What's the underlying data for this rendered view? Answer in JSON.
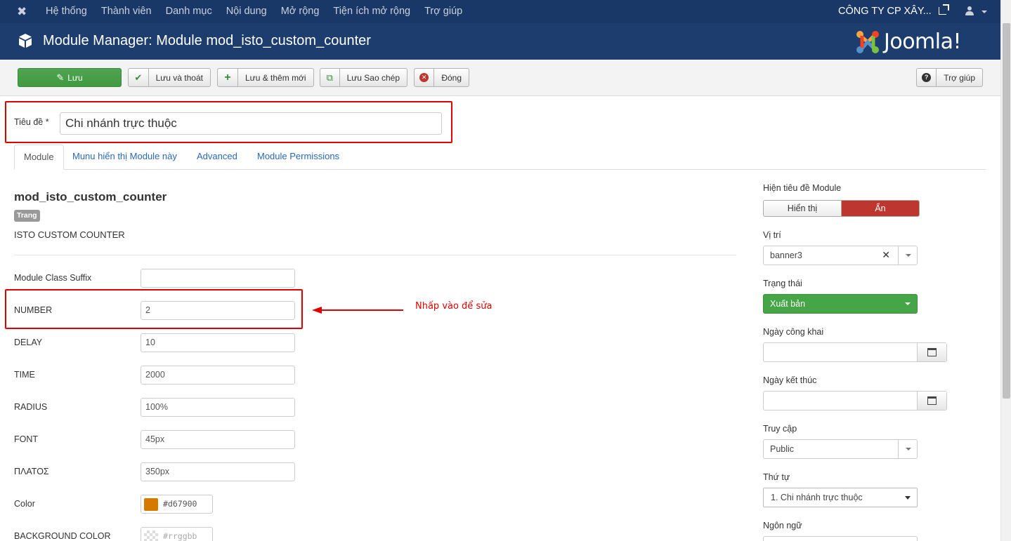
{
  "navbar": {
    "menu": [
      "Hệ thống",
      "Thành viên",
      "Danh mục",
      "Nội dung",
      "Mở rộng",
      "Tiện ích mở rộng",
      "Trợ giúp"
    ],
    "site_name": "CÔNG TY CP XÂY..."
  },
  "header": {
    "title": "Module Manager: Module mod_isto_custom_counter",
    "logo_text": "Joomla!"
  },
  "toolbar": {
    "save": "Lưu",
    "save_close": "Lưu và thoát",
    "save_new": "Lưu & thêm mới",
    "save_copy": "Lưu Sao chép",
    "close": "Đóng",
    "help": "Trợ giúp"
  },
  "title_field": {
    "label": "Tiêu đề *",
    "value": "Chi nhánh trực thuộc"
  },
  "tabs": [
    "Module",
    "Munu hiển thị Module này",
    "Advanced",
    "Module Permissions"
  ],
  "module": {
    "name": "mod_isto_custom_counter",
    "badge": "Trang",
    "description": "ISTO CUSTOM COUNTER"
  },
  "fields": [
    {
      "label": "Module Class Suffix",
      "value": ""
    },
    {
      "label": "NUMBER",
      "value": "2"
    },
    {
      "label": "DELAY",
      "value": "10"
    },
    {
      "label": "TIME",
      "value": "2000"
    },
    {
      "label": "RADIUS",
      "value": "100%"
    },
    {
      "label": "FONT",
      "value": "45px"
    },
    {
      "label": "ΠΛΑΤΟΣ",
      "value": "350px"
    }
  ],
  "color_fields": [
    {
      "label": "Color",
      "value": "#d67900",
      "swatch": "#d67900"
    },
    {
      "label": "BACKGROUND COLOR",
      "value": "#rrggbb",
      "swatch": "transparent"
    }
  ],
  "annotation": "Nhấp vào để sửa",
  "right": {
    "show_title_label": "Hiện tiêu đề Module",
    "show_option": "Hiển thị",
    "hide_option": "Ẩn",
    "position_label": "Vị trí",
    "position_value": "banner3",
    "status_label": "Trạng thái",
    "status_value": "Xuất bản",
    "publish_up_label": "Ngày công khai",
    "publish_down_label": "Ngày kết thúc",
    "access_label": "Truy cập",
    "access_value": "Public",
    "ordering_label": "Thứ tự",
    "ordering_value": "1. Chi nhánh trực thuộc",
    "language_label": "Ngôn ngữ"
  },
  "colors": {
    "navbar": "#1a3867",
    "header": "#1c3d6e",
    "save_green": "#46a546",
    "hide_red": "#bd362f",
    "highlight_red": "#e00000"
  }
}
